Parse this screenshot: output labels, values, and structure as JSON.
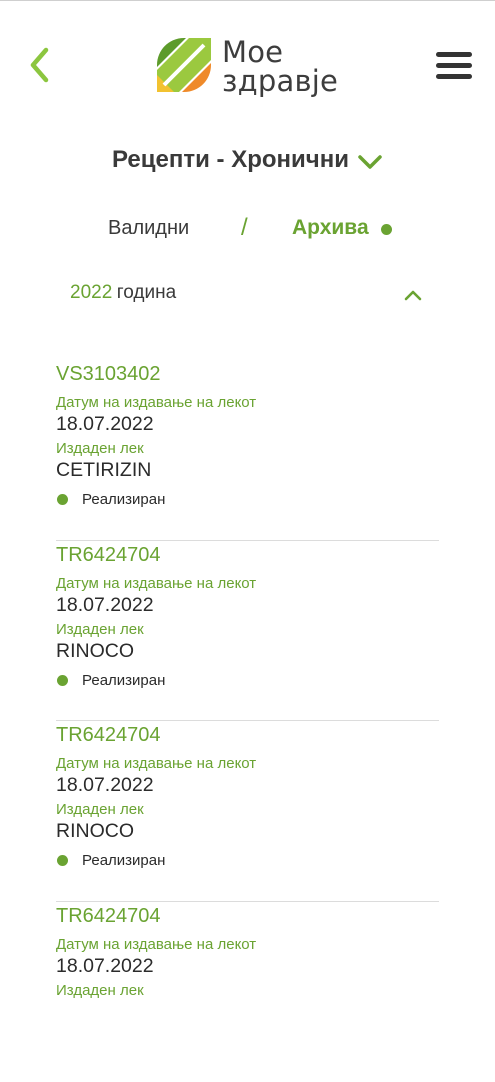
{
  "header": {
    "logo_line1": "Мое",
    "logo_line2": "здравје",
    "colors": {
      "green_dark": "#5d9b2b",
      "green_light": "#9bc93f",
      "yellow": "#f2c230",
      "orange": "#ef8a2a"
    }
  },
  "title": {
    "text": "Рецепти - Хронични",
    "icon": "chevron-down-icon"
  },
  "tabs": {
    "valid": "Валидни",
    "separator": "/",
    "archive": "Архива"
  },
  "year": {
    "number": "2022",
    "label": "година"
  },
  "prescriptions": [
    {
      "code": "VS3103402",
      "date_label": "Датум на издавање на лекот",
      "date": "18.07.2022",
      "drug_label": "Издаден лек",
      "drug": "CETIRIZIN",
      "status": "Реализиран"
    },
    {
      "code": "TR6424704",
      "date_label": "Датум на издавање на лекот",
      "date": "18.07.2022",
      "drug_label": "Издаден лек",
      "drug": "RINOCO",
      "status": "Реализиран"
    },
    {
      "code": "TR6424704",
      "date_label": "Датум на издавање на лекот",
      "date": "18.07.2022",
      "drug_label": "Издаден лек",
      "drug": "RINOCO",
      "status": "Реализиран"
    },
    {
      "code": "TR6424704",
      "date_label": "Датум на издавање на лекот",
      "date": "18.07.2022",
      "drug_label": "Издаден лек",
      "drug": "",
      "status": ""
    }
  ],
  "accent_color": "#6aa332"
}
